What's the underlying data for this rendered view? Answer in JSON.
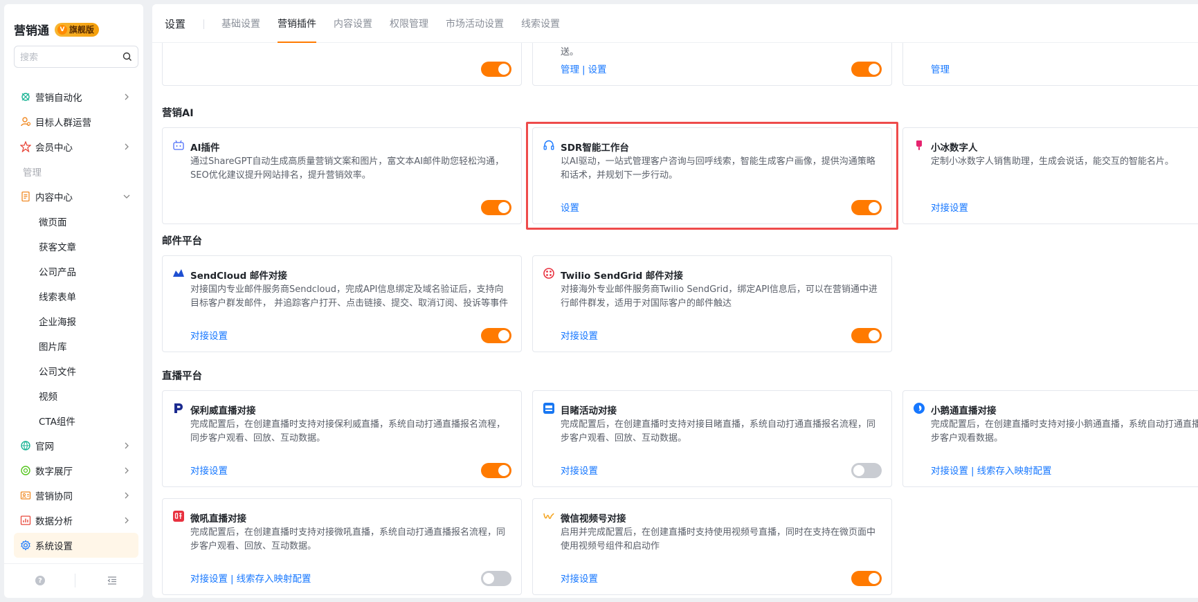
{
  "brand": {
    "name": "营销通",
    "badge": "旗舰版",
    "badge_letter": "V"
  },
  "search": {
    "placeholder": "搜索"
  },
  "nav": {
    "items": [
      {
        "label": "营销自动化"
      },
      {
        "label": "目标人群运营"
      },
      {
        "label": "会员中心"
      }
    ],
    "section": "管理",
    "content_center": "内容中心",
    "sub_items": [
      "微页面",
      "获客文章",
      "公司产品",
      "线索表单",
      "企业海报",
      "图片库",
      "公司文件",
      "视频",
      "CTA组件"
    ],
    "bottom_items": [
      {
        "label": "官网"
      },
      {
        "label": "数字展厅"
      },
      {
        "label": "营销协同"
      },
      {
        "label": "数据分析"
      },
      {
        "label": "系统设置"
      }
    ]
  },
  "topbar": {
    "title": "设置",
    "tabs": [
      "基础设置",
      "营销插件",
      "内容设置",
      "权限管理",
      "市场活动设置",
      "线索设置"
    ]
  },
  "top_partial": {
    "card2_desc_tail": "送。",
    "card2_links": [
      "管理",
      "设置"
    ],
    "card3_links": [
      "管理"
    ]
  },
  "sections": {
    "ai": "营销AI",
    "mail": "邮件平台",
    "live": "直播平台"
  },
  "cards": {
    "ai_plugin": {
      "title": "AI插件",
      "desc": "通过ShareGPT自动生成高质量营销文案和图片，富文本AI邮件助您轻松沟通，SEO优化建议提升网站排名，提升营销效率。"
    },
    "sdr": {
      "title": "SDR智能工作台",
      "desc": "以AI驱动，一站式管理客户咨询与回呼线索，智能生成客户画像，提供沟通策略和话术，并规划下一步行动。",
      "links": [
        "设置"
      ]
    },
    "xiaobing": {
      "title": "小冰数字人",
      "desc": "定制小冰数字人销售助理，生成会说话，能交互的智能名片。",
      "links": [
        "对接设置"
      ]
    },
    "sendcloud": {
      "title": "SendCloud 邮件对接",
      "desc": "对接国内专业邮件服务商Sendcloud，完成API信息绑定及域名验证后，支持向目标客户群发邮件， 并追踪客户打开、点击链接、提交、取消订阅、投诉等事件",
      "links": [
        "对接设置"
      ]
    },
    "twilio": {
      "title": "Twilio SendGrid 邮件对接",
      "desc": "对接海外专业邮件服务商Twilio SendGrid，绑定API信息后，可以在营销通中进行邮件群发，适用于对国际客户的邮件触达",
      "links": [
        "对接设置"
      ]
    },
    "polyv": {
      "title": "保利威直播对接",
      "desc": "完成配置后，在创建直播时支持对接保利威直播，系统自动打通直播报名流程，同步客户观看、回放、互动数据。",
      "links": [
        "对接设置"
      ]
    },
    "mudu": {
      "title": "目睹活动对接",
      "desc": "完成配置后，在创建直播时支持对接目睹直播，系统自动打通直播报名流程，同步客户观看、回放、互动数据。",
      "links": [
        "对接设置"
      ]
    },
    "xiaoe": {
      "title": "小鹅通直播对接",
      "desc": "完成配置后，在创建直播时支持对接小鹅通直播，系统自动打通直播报名流程，同步客户观看数据。",
      "links": [
        "对接设置",
        "线索存入映射配置"
      ]
    },
    "weihou": {
      "title": "微吼直播对接",
      "desc": "完成配置后，在创建直播时支持对接微吼直播，系统自动打通直播报名流程，同步客户观看、回放、互动数据。",
      "links": [
        "对接设置",
        "线索存入映射配置"
      ]
    },
    "wechat_video": {
      "title": "微信视频号对接",
      "desc": "启用并完成配置后，在创建直播时支持使用视频号直播，同时在支持在微页面中使用视频号组件和启动作",
      "links": [
        "对接设置"
      ]
    }
  },
  "toggles": {
    "top1": true,
    "top2": true,
    "ai_plugin": true,
    "sdr": true,
    "sendcloud": true,
    "twilio": true,
    "polyv": true,
    "mudu": false,
    "weihou": false,
    "wechat_video": true
  },
  "colors": {
    "accent": "#ff7a00",
    "link": "#1677ff",
    "highlight": "#ee4b4b",
    "toggle_off": "#c9ccd2"
  },
  "footer": {
    "help_icon": "?"
  }
}
